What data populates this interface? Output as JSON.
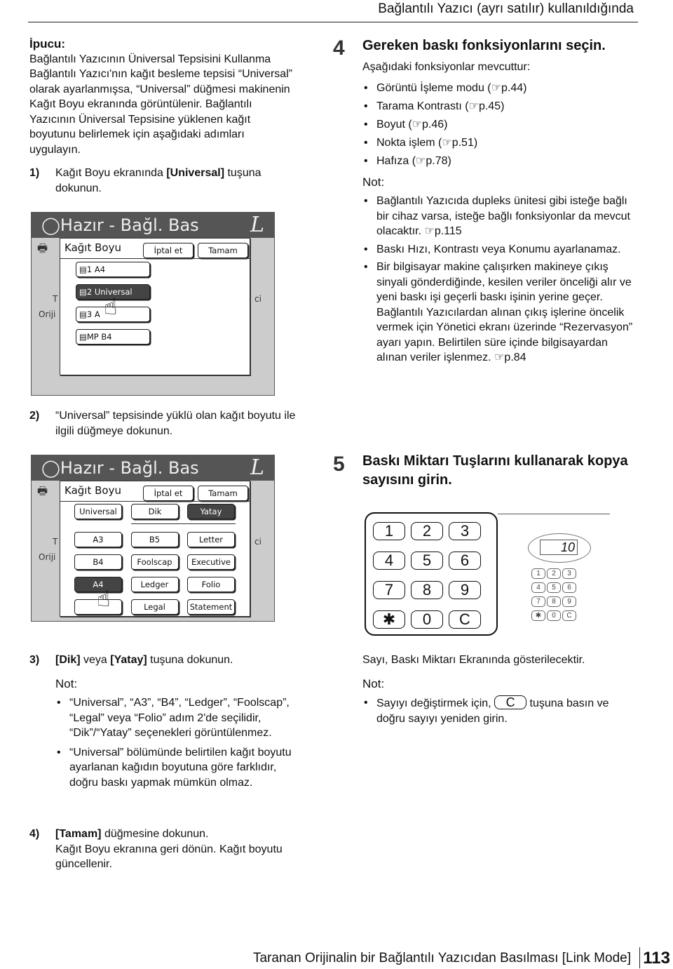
{
  "header": "Bağlantılı Yazıcı (ayrı satılır) kullanıldığında",
  "tip": {
    "title": "İpucu:",
    "subtitle": "Bağlantılı Yazıcının Üniversal Tepsisini Kullanma",
    "body": "Bağlantılı Yazıcı'nın kağıt besleme tepsisi “Universal” olarak ayarlanmışsa, “Universal” düğmesi makinenin Kağıt Boyu ekranında görüntülenir. Bağlantılı Yazıcının Üniversal Tepsisine yüklenen kağıt boyutunu belirlemek için aşağıdaki adımları uygulayın."
  },
  "substeps": [
    {
      "num": "1)",
      "text": "Kağıt Boyu ekranında ",
      "bold": "[Universal]",
      "after": " tuşuna dokunun."
    },
    {
      "num": "2)",
      "text": "“Universal” tepsisinde yüklü olan kağıt boyutu ile ilgili düğmeye dokunun."
    },
    {
      "num": "3)",
      "bold": "[Dik]",
      "mid": " veya ",
      "bold2": "[Yatay]",
      "after": " tuşuna dokunun."
    },
    {
      "num": "4)",
      "bold": "[Tamam]",
      "after": " düğmesine dokunun.",
      "extra": "Kağıt Boyu ekranına geri dönün. Kağıt boyutu güncellenir."
    }
  ],
  "screen1": {
    "status": "Hazır - Bağl. Bas",
    "mode": "L",
    "dialog_title": "Kağıt Boyu",
    "cancel": "İptal et",
    "ok": "Tamam",
    "trays": [
      "1  A4",
      "2  Universal",
      "3  A",
      "MP   B4"
    ],
    "side_left": [
      "T",
      "Oriji"
    ],
    "side_right": "ci"
  },
  "screen2": {
    "status": "Hazır - Bağl. Bas",
    "mode": "L",
    "dialog_title": "Kağıt Boyu",
    "cancel": "İptal et",
    "ok": "Tamam",
    "orient": [
      "Universal",
      "Dik",
      "Yatay"
    ],
    "sizes": [
      "A3",
      "B5",
      "Letter",
      "B4",
      "Foolscap",
      "Executive",
      "A4",
      "Ledger",
      "Folio",
      "",
      "Legal",
      "Statement"
    ],
    "side_left": [
      "T",
      "Oriji"
    ],
    "side_right": "ci"
  },
  "note3": {
    "title": "Not:",
    "items": [
      "“Universal”, “A3”, “B4”, “Ledger”, “Foolscap”, “Legal” veya “Folio” adım 2'de seçilidir, “Dik”/“Yatay” seçenekleri görüntülenmez.",
      "“Universal” bölümünde belirtilen kağıt boyutu ayarlanan kağıdın boyutuna göre farklıdır, doğru baskı yapmak mümkün olmaz."
    ]
  },
  "step4": {
    "num": "4",
    "title": "Gereken baskı fonksiyonlarını seçin.",
    "intro": "Aşağıdaki fonksiyonlar mevcuttur:",
    "items": [
      "Görüntü İşleme modu (☞p.44)",
      "Tarama Kontrastı (☞p.45)",
      "Boyut (☞p.46)",
      "Nokta işlem (☞p.51)",
      "Hafıza (☞p.78)"
    ],
    "note_title": "Not:",
    "notes": [
      "Bağlantılı Yazıcıda dupleks ünitesi gibi isteğe bağlı bir cihaz varsa, isteğe bağlı fonksiyonlar da mevcut olacaktır. ☞p.115",
      "Baskı Hızı, Kontrastı veya Konumu ayarlanamaz.",
      "Bir bilgisayar makine çalışırken makineye çıkış sinyali gönderdiğinde, kesilen veriler önceliği alır ve yeni baskı işi geçerli baskı işinin yerine geçer. Bağlantılı Yazıcılardan alınan çıkış işlerine öncelik vermek için Yönetici ekranı üzerinde “Rezervasyon” ayarı yapın. Belirtilen süre içinde bilgisayardan alınan veriler işlenmez. ☞p.84"
    ]
  },
  "step5": {
    "num": "5",
    "title": "Baskı Miktarı Tuşlarını kullanarak kopya sayısını girin.",
    "keys": [
      "1",
      "2",
      "3",
      "4",
      "5",
      "6",
      "7",
      "8",
      "9",
      "✱",
      "0",
      "C"
    ],
    "display": "10",
    "result": "Sayı, Baskı Miktarı Ekranında gösterilecektir.",
    "note_title": "Not:",
    "note_pre": "Sayıyı değiştirmek için, ",
    "note_key": "C",
    "note_post": " tuşuna basın ve doğru sayıyı yeniden girin."
  },
  "footer": {
    "title": "Taranan Orijinalin bir Bağlantılı Yazıcıdan Basılması [Link Mode]",
    "page": "113"
  }
}
